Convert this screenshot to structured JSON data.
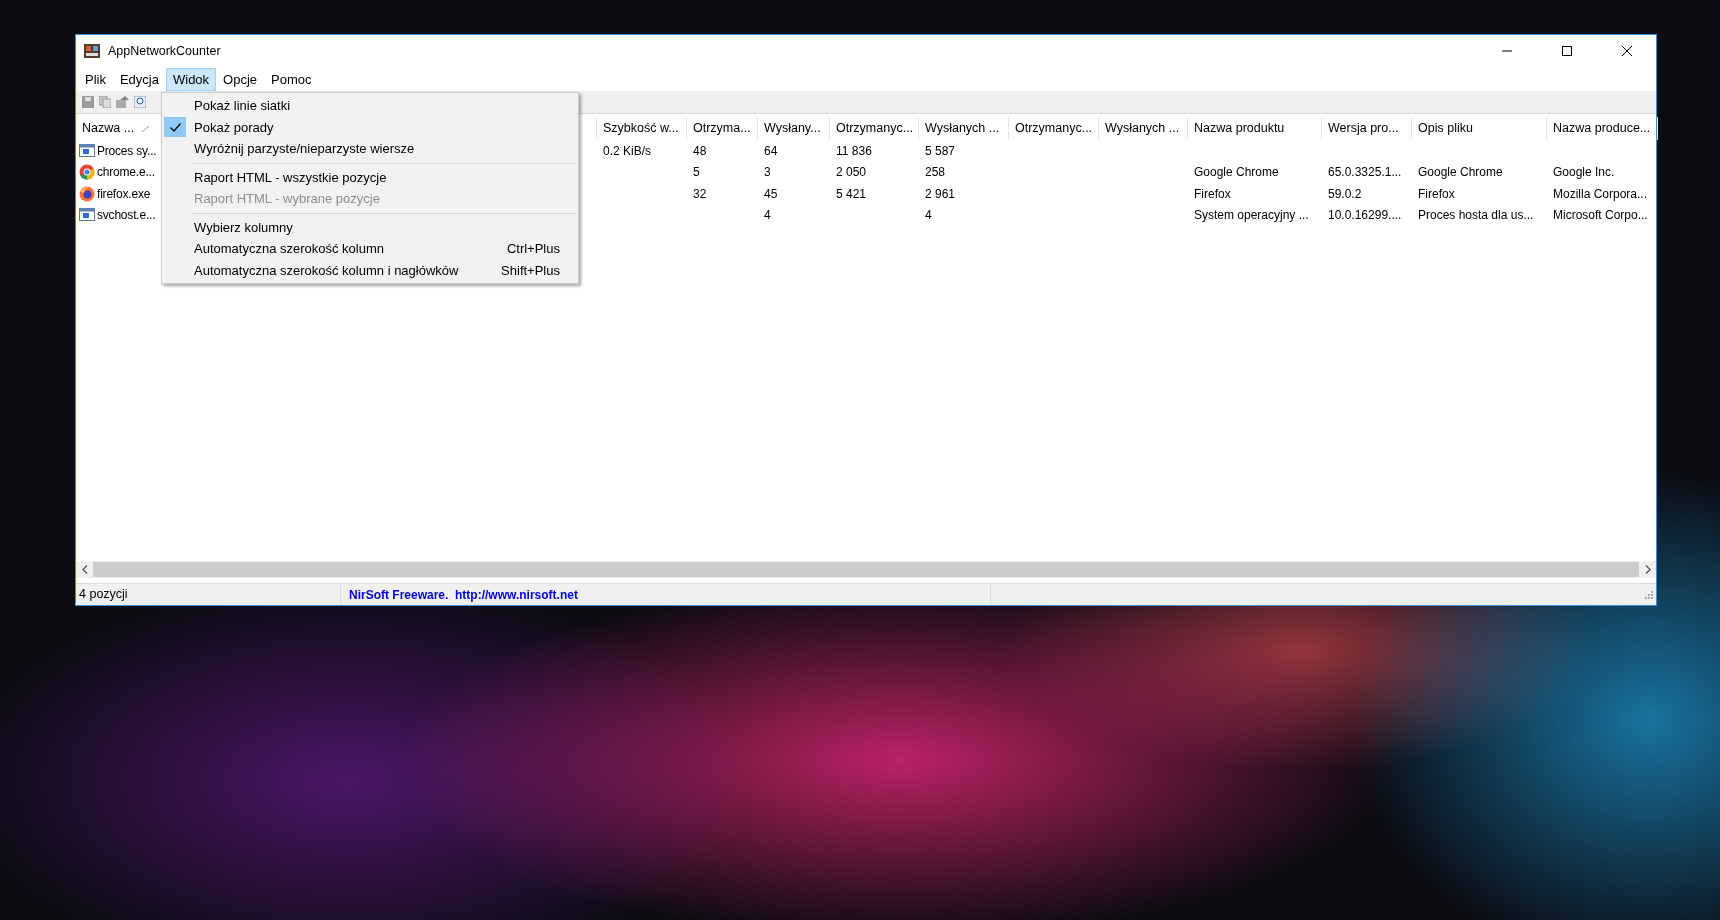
{
  "window": {
    "title": "AppNetworkCounter"
  },
  "menu_bar": [
    {
      "label": "Plik",
      "selected": false
    },
    {
      "label": "Edycja",
      "selected": false
    },
    {
      "label": "Widok",
      "selected": true
    },
    {
      "label": "Opcje",
      "selected": false
    },
    {
      "label": "Pomoc",
      "selected": false
    }
  ],
  "open_menu": [
    {
      "kind": "item",
      "label": "Pokaż linie siatki",
      "checked": false,
      "disabled": false
    },
    {
      "kind": "item",
      "label": "Pokaż porady",
      "checked": true,
      "disabled": false
    },
    {
      "kind": "item",
      "label": "Wyróżnij parzyste/nieparzyste wiersze",
      "checked": false,
      "disabled": false
    },
    {
      "kind": "separator"
    },
    {
      "kind": "item",
      "label": "Raport HTML - wszystkie pozycje",
      "checked": false,
      "disabled": false
    },
    {
      "kind": "item",
      "label": "Raport HTML - wybrane pozycje",
      "checked": false,
      "disabled": true
    },
    {
      "kind": "separator"
    },
    {
      "kind": "item",
      "label": "Wybierz kolumny",
      "checked": false,
      "disabled": false
    },
    {
      "kind": "item",
      "label": "Automatyczna szerokość kolumn",
      "shortcut": "Ctrl+Plus",
      "checked": false,
      "disabled": false
    },
    {
      "kind": "item",
      "label": "Automatyczna szerokość kolumn i nagłówków",
      "shortcut": "Shift+Plus",
      "checked": false,
      "disabled": false
    }
  ],
  "table": {
    "first_column": "Nazwa ...",
    "columns": [
      "Szybkość w...",
      "Otrzyma...",
      "Wysłany...",
      "Otrzymanyc...",
      "Wysłanych ...",
      "Otrzymanyc...",
      "Wysłanych ...",
      "Nazwa produktu",
      "Wersja pro...",
      "Opis pliku",
      "Nazwa produce..."
    ],
    "rows": [
      {
        "kind": "window",
        "name": "Proces sy...",
        "cells": [
          "0.2 KiB/s",
          "48",
          "64",
          "11 836",
          "5 587",
          "",
          "",
          "",
          "",
          "",
          ""
        ]
      },
      {
        "kind": "chrome",
        "name": "chrome.e...",
        "cells": [
          "",
          "5",
          "3",
          "2 050",
          "258",
          "",
          "",
          "Google Chrome",
          "65.0.3325.1...",
          "Google Chrome",
          "Google Inc."
        ]
      },
      {
        "kind": "firefox",
        "name": "firefox.exe",
        "cells": [
          "",
          "32",
          "45",
          "5 421",
          "2 961",
          "",
          "",
          "Firefox",
          "59.0.2",
          "Firefox",
          "Mozilla Corpora..."
        ]
      },
      {
        "kind": "window",
        "name": "svchost.e...",
        "cells": [
          "",
          "",
          "4",
          "",
          "4",
          "",
          "",
          "System operacyjny ...",
          "10.0.16299....",
          "Proces hosta dla us...",
          "Microsoft Corpo..."
        ]
      }
    ]
  },
  "status_bar": {
    "count": "4 pozycji",
    "credit": "NirSoft Freeware.  http://www.nirsoft.net"
  }
}
